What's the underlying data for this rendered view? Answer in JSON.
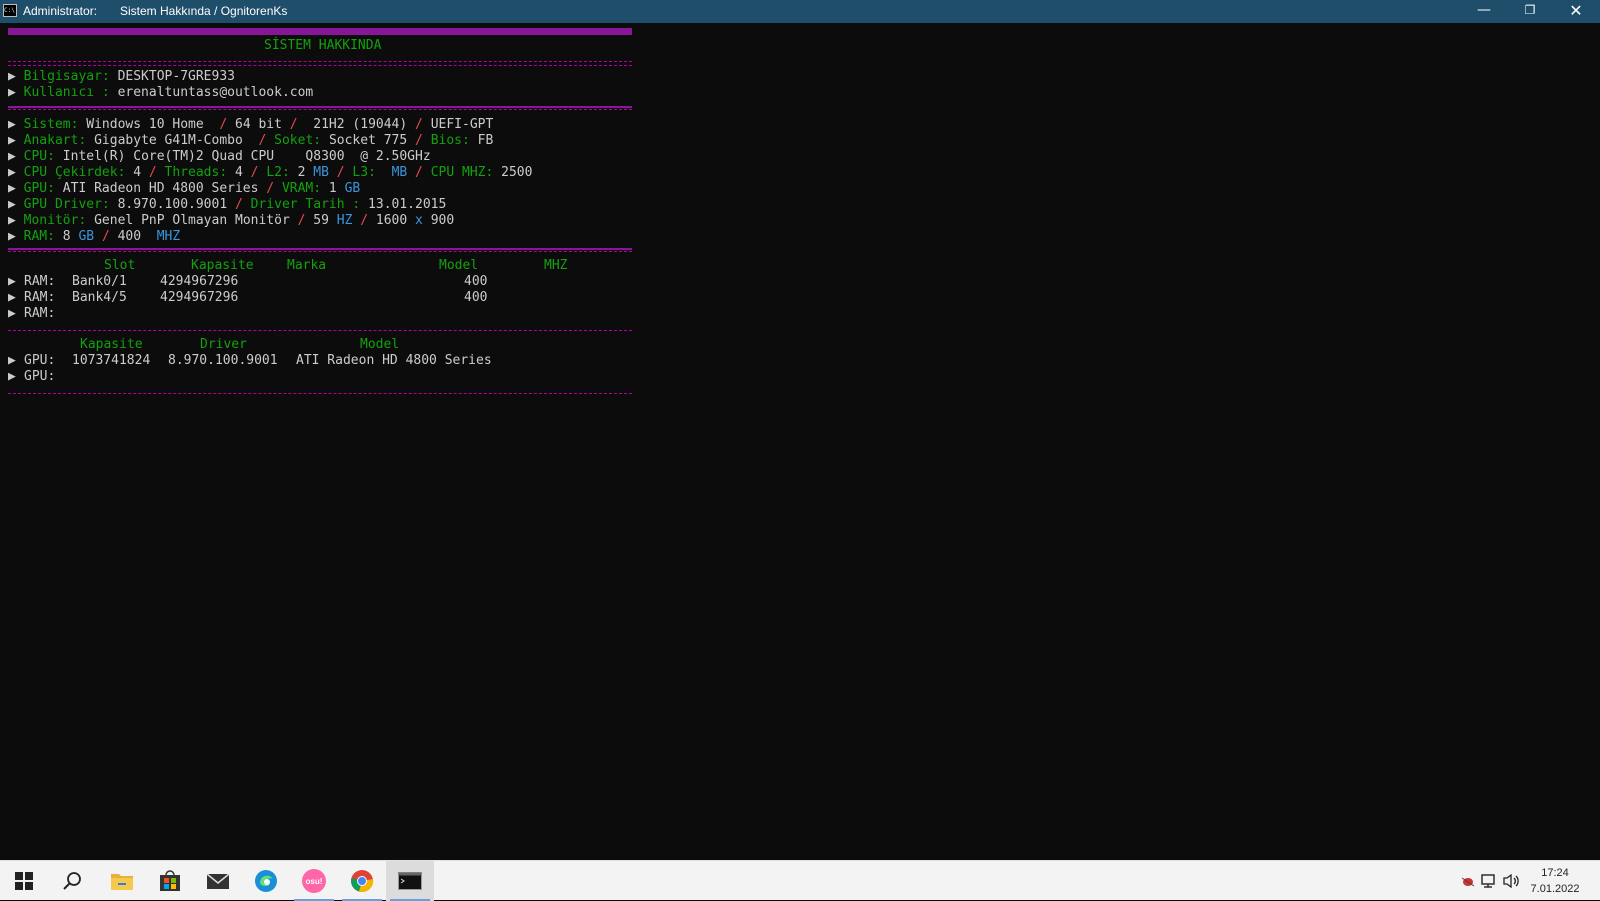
{
  "window": {
    "title_user": "Administrator:",
    "title_name": "Sistem Hakkında / OgnitorenKs",
    "icon_text": "C:\\"
  },
  "console": {
    "heading": "SİSTEM HAKKINDA",
    "arrow": "▶",
    "computer": {
      "label": "Bilgisayar:",
      "value": "DESKTOP-7GRE933"
    },
    "user": {
      "label": "Kullanıcı :",
      "value": "erenaltuntass@outlook.com"
    },
    "system": {
      "label": "Sistem:",
      "os": "Windows 10 Home",
      "arch": "64 bit",
      "version": "21H2 (19044)",
      "boot": "UEFI-GPT"
    },
    "board": {
      "label": "Anakart:",
      "value": "Gigabyte G41M-Combo",
      "socket_label": "Soket:",
      "socket": "Socket 775",
      "bios_label": "Bios:",
      "bios": "FB"
    },
    "cpu": {
      "label": "CPU:",
      "value": "Intel(R) Core(TM)2 Quad CPU    Q8300  @ 2.50GHz"
    },
    "cpu_detail": {
      "cores_label": "CPU Çekirdek:",
      "cores": "4",
      "threads_label": "Threads:",
      "threads": "4",
      "l2_label": "L2:",
      "l2": "2",
      "l2_unit": "MB",
      "l3_label": "L3:",
      "l3_unit": "MB",
      "mhz_label": "CPU MHZ:",
      "mhz": "2500"
    },
    "gpu": {
      "label": "GPU:",
      "value": "ATI Radeon HD 4800 Series",
      "vram_label": "VRAM:",
      "vram": "1",
      "vram_unit": "GB"
    },
    "gpu_driver": {
      "label": "GPU Driver:",
      "value": "8.970.100.9001",
      "date_label": "Driver Tarih :",
      "date": "13.01.2015"
    },
    "monitor": {
      "label": "Monitör:",
      "value": "Genel PnP Olmayan Monitör",
      "hz": "59",
      "hz_unit": "HZ",
      "w": "1600",
      "x": "x",
      "h": "900"
    },
    "ram": {
      "label": "RAM:",
      "size": "8",
      "size_unit": "GB",
      "speed": "400",
      "speed_unit": "MHZ"
    },
    "slash": "/",
    "ram_table": {
      "headers": [
        "Slot",
        "Kapasite",
        "Marka",
        "Model",
        "MHZ"
      ],
      "row_label": "RAM:",
      "rows": [
        {
          "slot": "Bank0/1",
          "capacity": "4294967296",
          "mhz": "400"
        },
        {
          "slot": "Bank4/5",
          "capacity": "4294967296",
          "mhz": "400"
        }
      ]
    },
    "gpu_table": {
      "headers": [
        "Kapasite",
        "Driver",
        "Model"
      ],
      "row_label": "GPU:",
      "rows": [
        {
          "capacity": "1073741824",
          "driver": "8.970.100.9001",
          "model": "ATI Radeon HD 4800 Series"
        }
      ]
    }
  },
  "taskbar": {
    "clock_time": "17:24",
    "clock_date": "7.01.2022",
    "osu_label": "osu!"
  }
}
